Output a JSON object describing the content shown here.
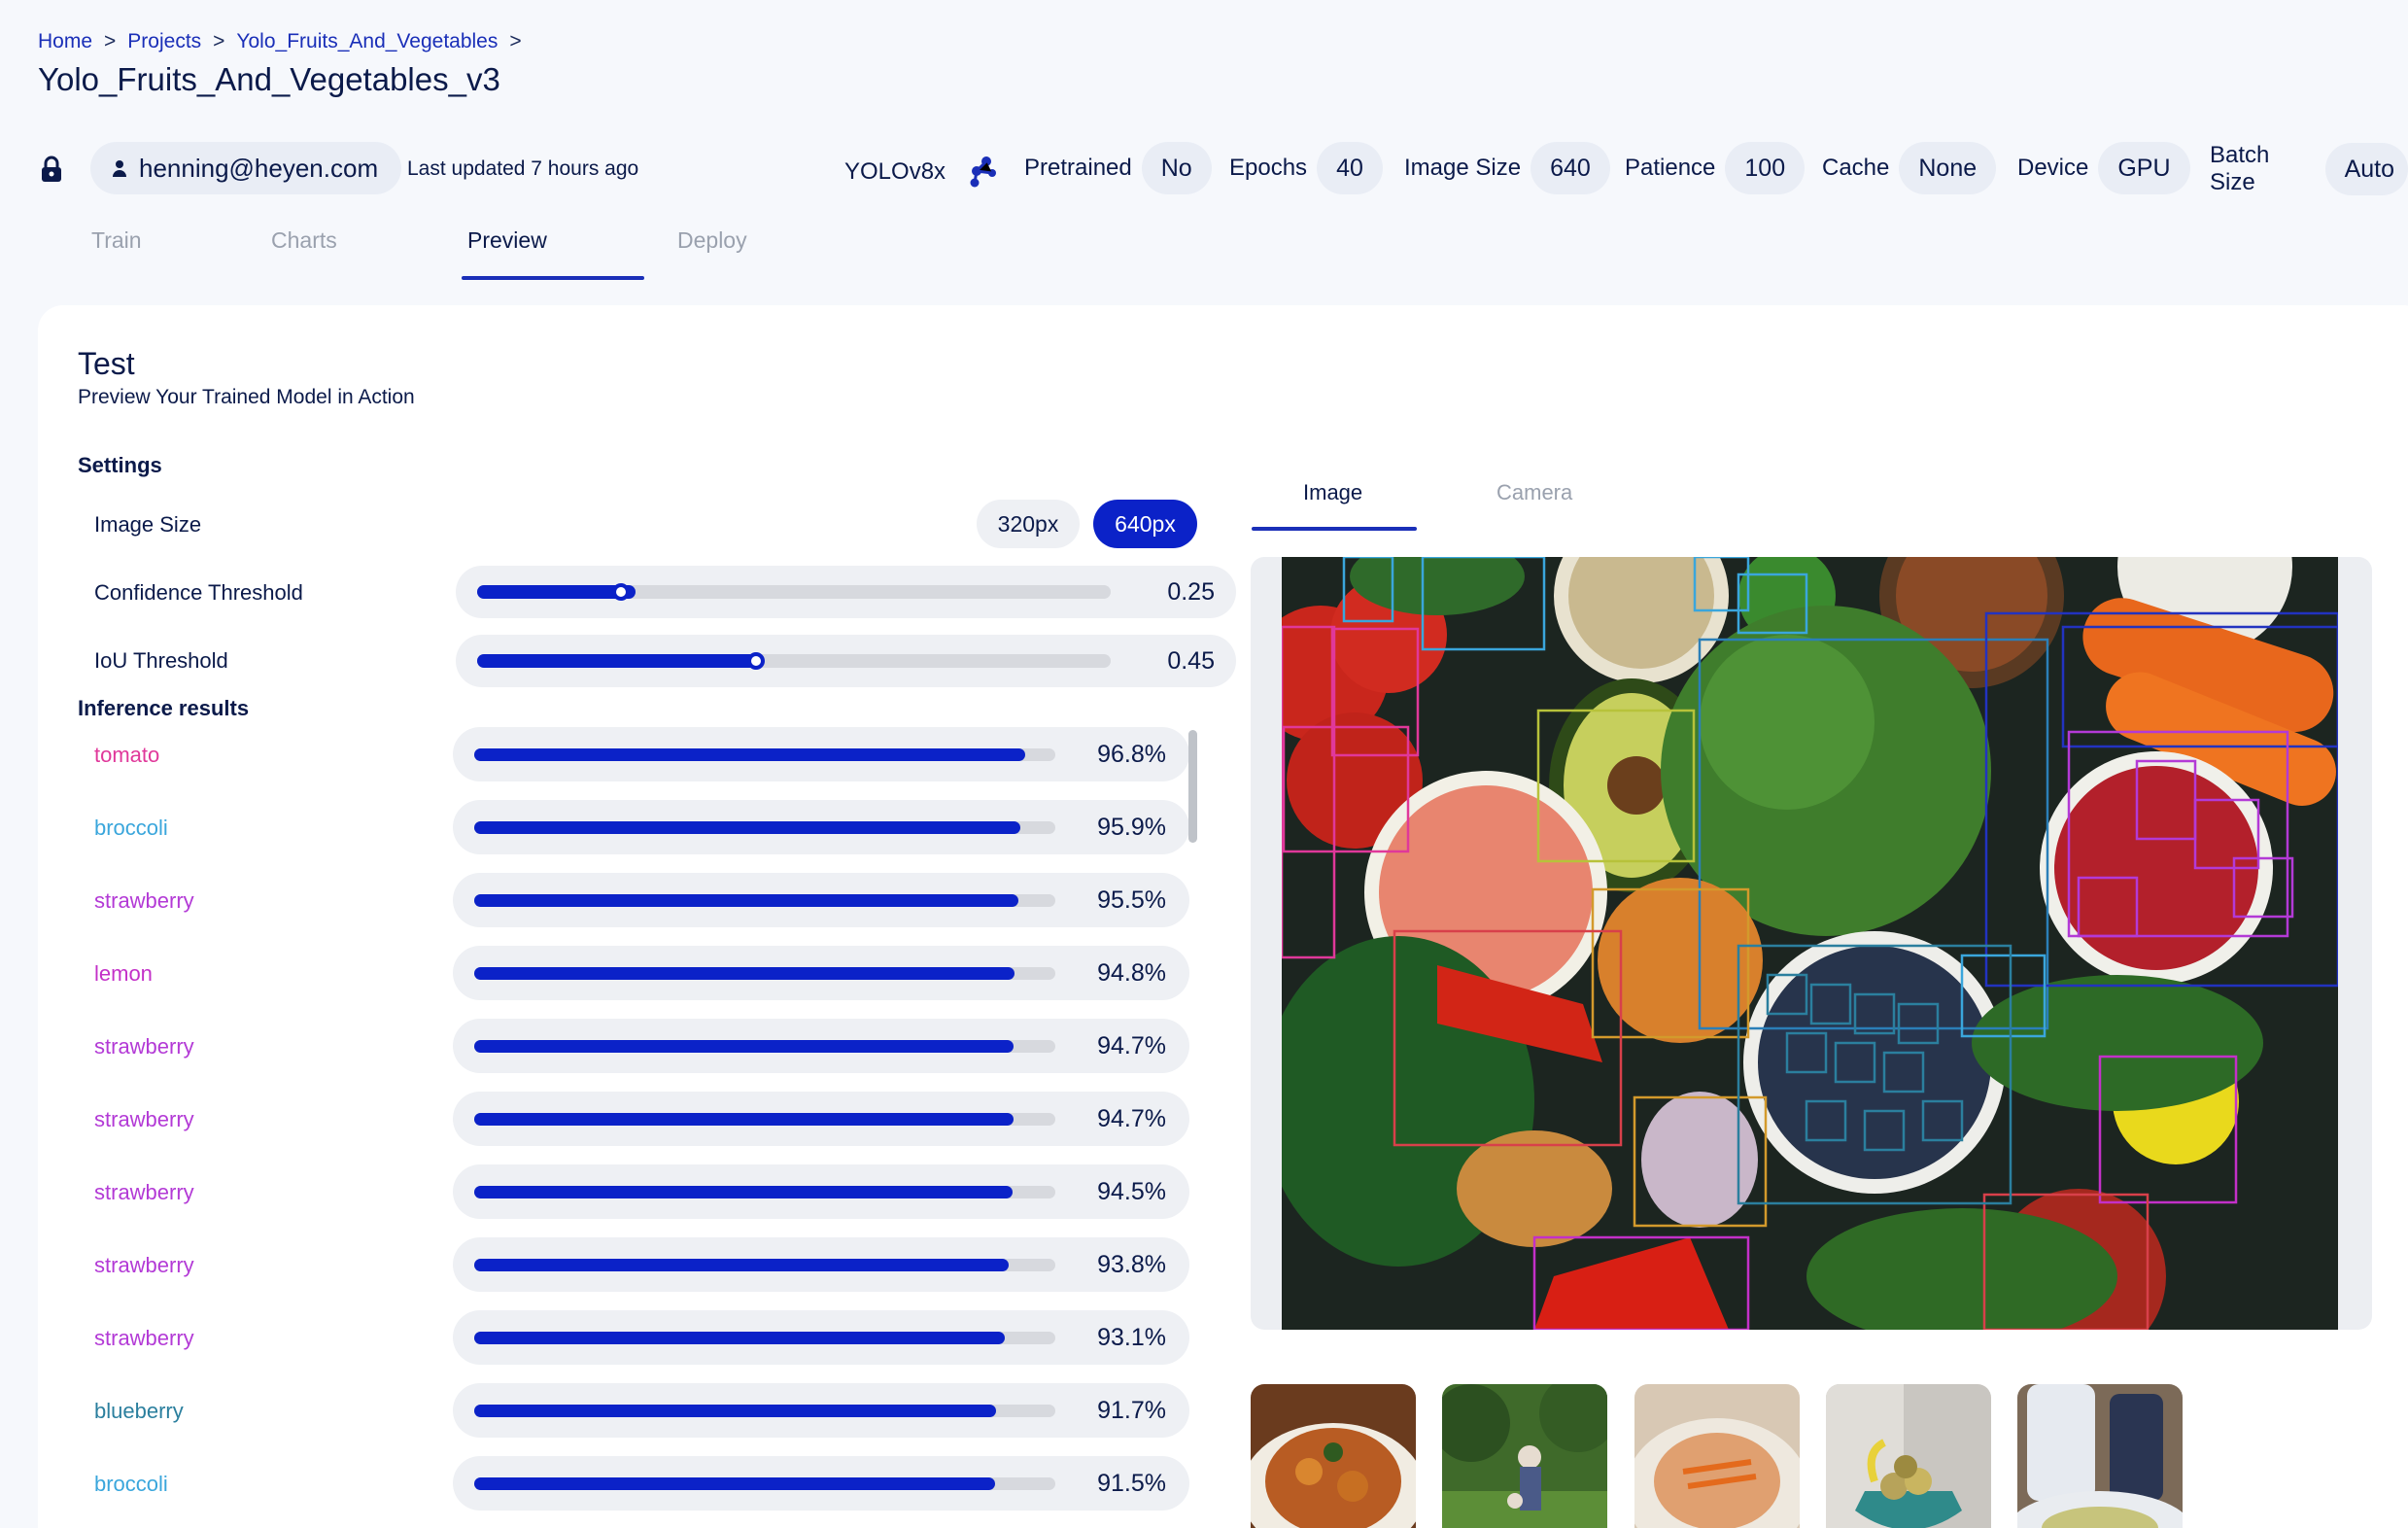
{
  "breadcrumb": {
    "items": [
      "Home",
      "Projects",
      "Yolo_Fruits_And_Vegetables"
    ],
    "separator": ">"
  },
  "page_title": "Yolo_Fruits_And_Vegetables_v3",
  "meta": {
    "user": "henning@heyen.com",
    "last_updated": "Last updated 7 hours ago",
    "model": "YOLOv8x",
    "config": [
      {
        "label": "Pretrained",
        "value": "No"
      },
      {
        "label": "Epochs",
        "value": "40"
      },
      {
        "label": "Image Size",
        "value": "640"
      },
      {
        "label": "Patience",
        "value": "100"
      },
      {
        "label": "Cache",
        "value": "None"
      },
      {
        "label": "Device",
        "value": "GPU"
      },
      {
        "label": "Batch Size",
        "value": "Auto"
      }
    ]
  },
  "tabs": [
    "Train",
    "Charts",
    "Preview",
    "Deploy"
  ],
  "active_tab": "Preview",
  "test": {
    "title": "Test",
    "subtitle": "Preview Your Trained Model in Action",
    "settings_label": "Settings",
    "image_size_label": "Image Size",
    "image_size_options": [
      "320px",
      "640px"
    ],
    "image_size_selected": "640px",
    "confidence_label": "Confidence Threshold",
    "confidence_value": "0.25",
    "iou_label": "IoU Threshold",
    "iou_value": "0.45",
    "inference_label": "Inference results"
  },
  "results": [
    {
      "name": "tomato",
      "pct": "96.8%",
      "value": 0.968,
      "color": "#e0389a"
    },
    {
      "name": "broccoli",
      "pct": "95.9%",
      "value": 0.959,
      "color": "#3aa6dc"
    },
    {
      "name": "strawberry",
      "pct": "95.5%",
      "value": 0.955,
      "color": "#b33ad6"
    },
    {
      "name": "lemon",
      "pct": "94.8%",
      "value": 0.948,
      "color": "#c330c8"
    },
    {
      "name": "strawberry",
      "pct": "94.7%",
      "value": 0.947,
      "color": "#b33ad6"
    },
    {
      "name": "strawberry",
      "pct": "94.7%",
      "value": 0.947,
      "color": "#b33ad6"
    },
    {
      "name": "strawberry",
      "pct": "94.5%",
      "value": 0.945,
      "color": "#b33ad6"
    },
    {
      "name": "strawberry",
      "pct": "93.8%",
      "value": 0.938,
      "color": "#b33ad6"
    },
    {
      "name": "strawberry",
      "pct": "93.1%",
      "value": 0.931,
      "color": "#b33ad6"
    },
    {
      "name": "blueberry",
      "pct": "91.7%",
      "value": 0.917,
      "color": "#2b7f9e"
    },
    {
      "name": "broccoli",
      "pct": "91.5%",
      "value": 0.915,
      "color": "#3aa6dc"
    }
  ],
  "preview_tabs": [
    "Image",
    "Camera"
  ],
  "preview_active": "Image",
  "colors": {
    "accent": "#0b22c8",
    "text": "#0b1a4a",
    "muted": "#9aa1ae",
    "background": "#f6f8fc"
  }
}
